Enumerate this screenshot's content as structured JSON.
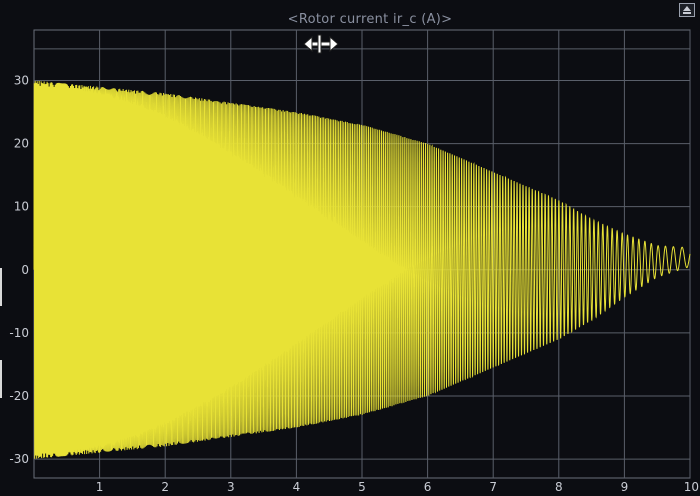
{
  "window": {
    "title": "<Rotor current ir_c (A)>",
    "restore_icon": "restore-icon",
    "cursor_icon": "horizontal-zoom-cursor-icon"
  },
  "colors": {
    "background": "#0c0d12",
    "grid": "#5a5f6a",
    "signal": "#e8e236",
    "text": "#c9ccd4"
  },
  "chart_data": {
    "type": "line",
    "title": "<Rotor current ir_c (A)>",
    "xlabel": "",
    "ylabel": "",
    "xlim": [
      0,
      10
    ],
    "ylim": [
      -33,
      38
    ],
    "x_ticks": [
      "1",
      "2",
      "3",
      "4",
      "5",
      "6",
      "7",
      "8",
      "9",
      "10"
    ],
    "y_ticks": [
      "30",
      "20",
      "10",
      "0",
      "-10",
      "-20",
      "-30"
    ],
    "y_tick_values": [
      30,
      20,
      10,
      0,
      -10,
      -20,
      -30
    ],
    "grid": true,
    "legend": "none",
    "series": [
      {
        "signal": "damped sinusoid with rising frequency",
        "envelope_points": [
          {
            "x": 0.0,
            "amp": 30
          },
          {
            "x": 1.0,
            "amp": 29
          },
          {
            "x": 2.0,
            "amp": 28
          },
          {
            "x": 3.0,
            "amp": 26.5
          },
          {
            "x": 4.0,
            "amp": 25
          },
          {
            "x": 5.0,
            "amp": 23
          },
          {
            "x": 6.0,
            "amp": 20
          },
          {
            "x": 7.0,
            "amp": 15.5
          },
          {
            "x": 8.0,
            "amp": 11
          },
          {
            "x": 8.5,
            "amp": 8
          },
          {
            "x": 9.0,
            "amp": 5
          },
          {
            "x": 9.5,
            "amp": 2.5
          },
          {
            "x": 10.0,
            "amp": 1.5
          }
        ],
        "offset_end": 2
      }
    ]
  }
}
